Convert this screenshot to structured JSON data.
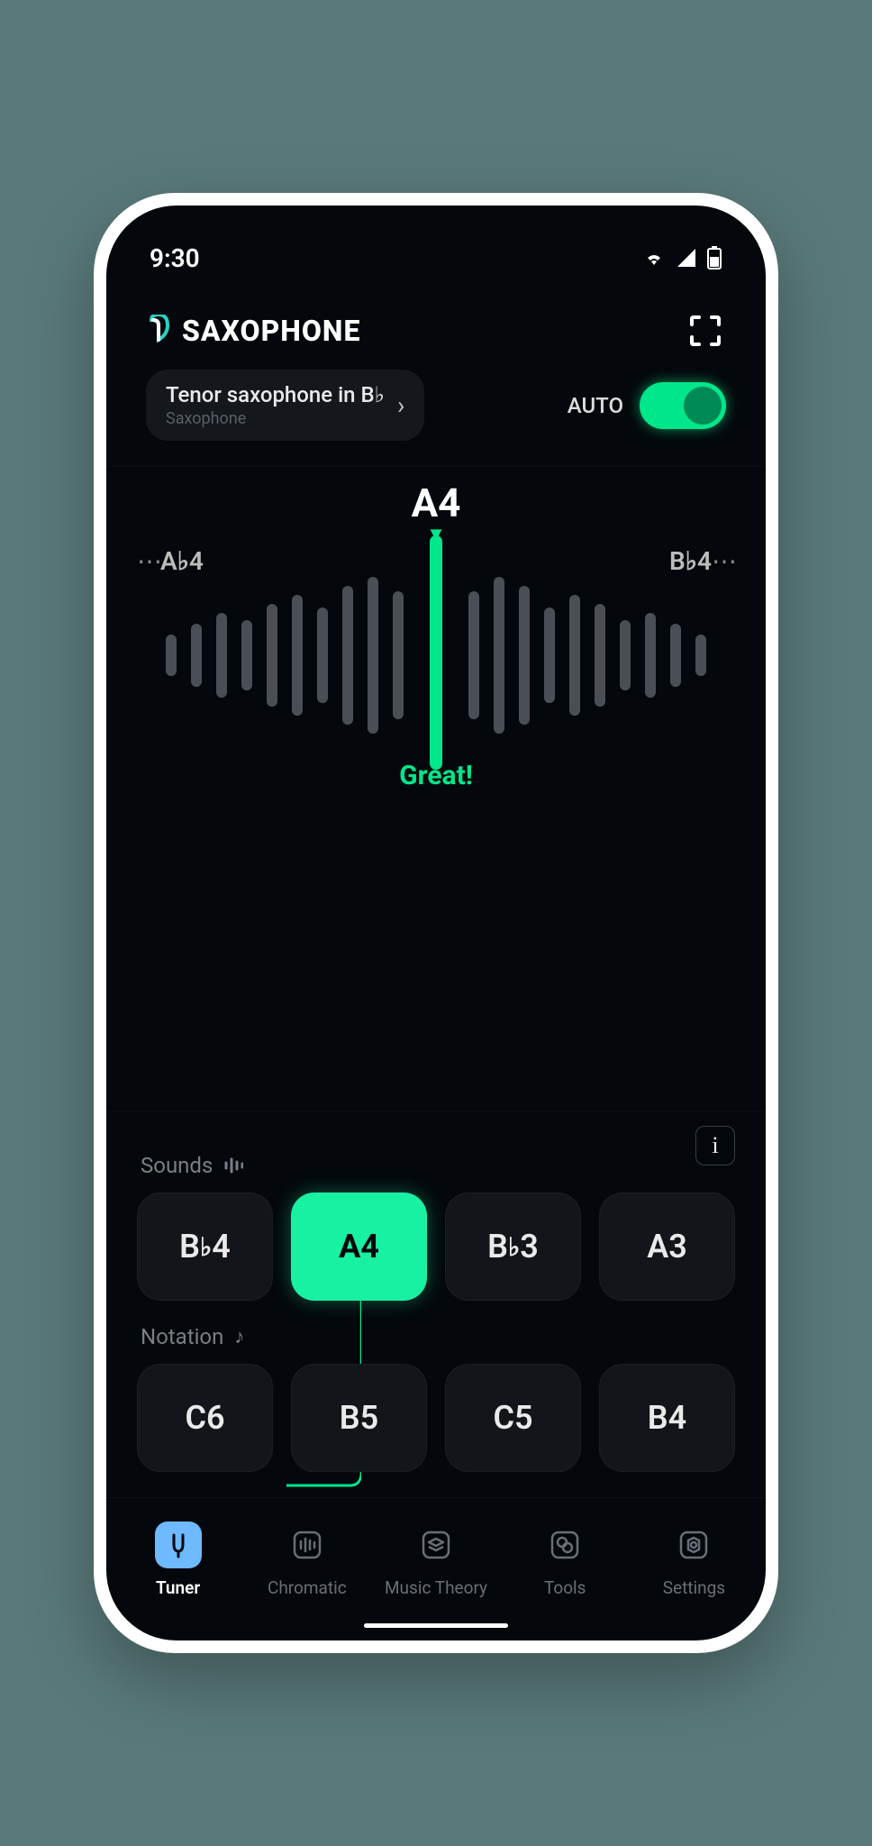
{
  "status": {
    "time": "9:30"
  },
  "header": {
    "app_name": "SAXOPHONE"
  },
  "selector": {
    "instrument": "Tenor saxophone in B♭",
    "category": "Saxophone",
    "auto_label": "AUTO",
    "auto_on": true
  },
  "tuner": {
    "current_note": "A4",
    "left_note": "A♭4",
    "right_note": "B♭4",
    "feedback": "Great!",
    "accent": "#00e68a"
  },
  "sounds": {
    "label": "Sounds",
    "items": [
      "B♭4",
      "A4",
      "B♭3",
      "A3"
    ],
    "active_index": 1
  },
  "notation": {
    "label": "Notation",
    "items": [
      "C6",
      "B5",
      "C5",
      "B4"
    ]
  },
  "info_label": "i",
  "nav": {
    "items": [
      {
        "label": "Tuner"
      },
      {
        "label": "Chromatic"
      },
      {
        "label": "Music Theory"
      },
      {
        "label": "Tools"
      },
      {
        "label": "Settings"
      }
    ],
    "active_index": 0
  }
}
